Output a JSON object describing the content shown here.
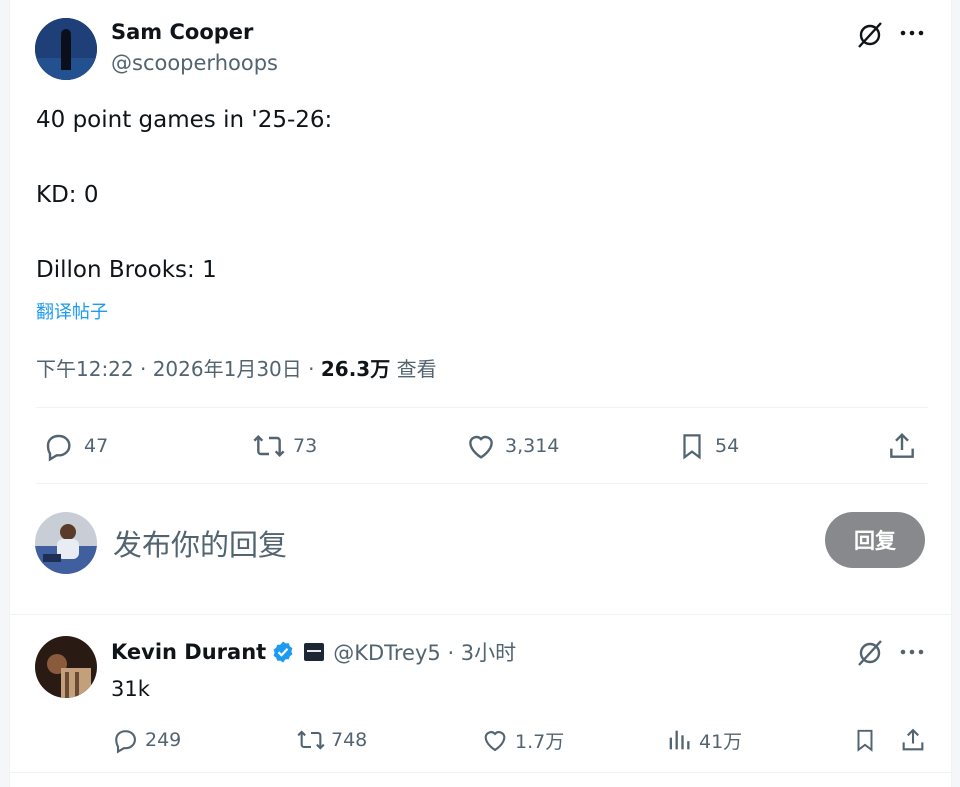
{
  "main_tweet": {
    "author_name": "Sam Cooper",
    "author_handle": "@scooperhoops",
    "text_lines": [
      "40 point games in '25-26:",
      "KD: 0",
      "Dillon Brooks: 1"
    ],
    "translate_label": "翻译帖子",
    "timestamp": "下午12:22 · 2026年1月30日 · ",
    "views_count": "26.3万",
    "views_label": " 查看",
    "stats": {
      "replies": "47",
      "retweets": "73",
      "likes": "3,314",
      "bookmarks": "54"
    }
  },
  "composer": {
    "placeholder": "发布你的回复",
    "reply_button": "回复"
  },
  "reply_tweet": {
    "author_name": "Kevin Durant",
    "author_handle": "@KDTrey5 · 3小时",
    "text": "31k",
    "stats": {
      "replies": "249",
      "retweets": "748",
      "likes": "1.7万",
      "views": "41万"
    }
  },
  "colors": {
    "accent": "#1d9bf0",
    "verified": "#1d9bf0",
    "muted": "#536471",
    "reply_button_bg": "#87898c"
  }
}
